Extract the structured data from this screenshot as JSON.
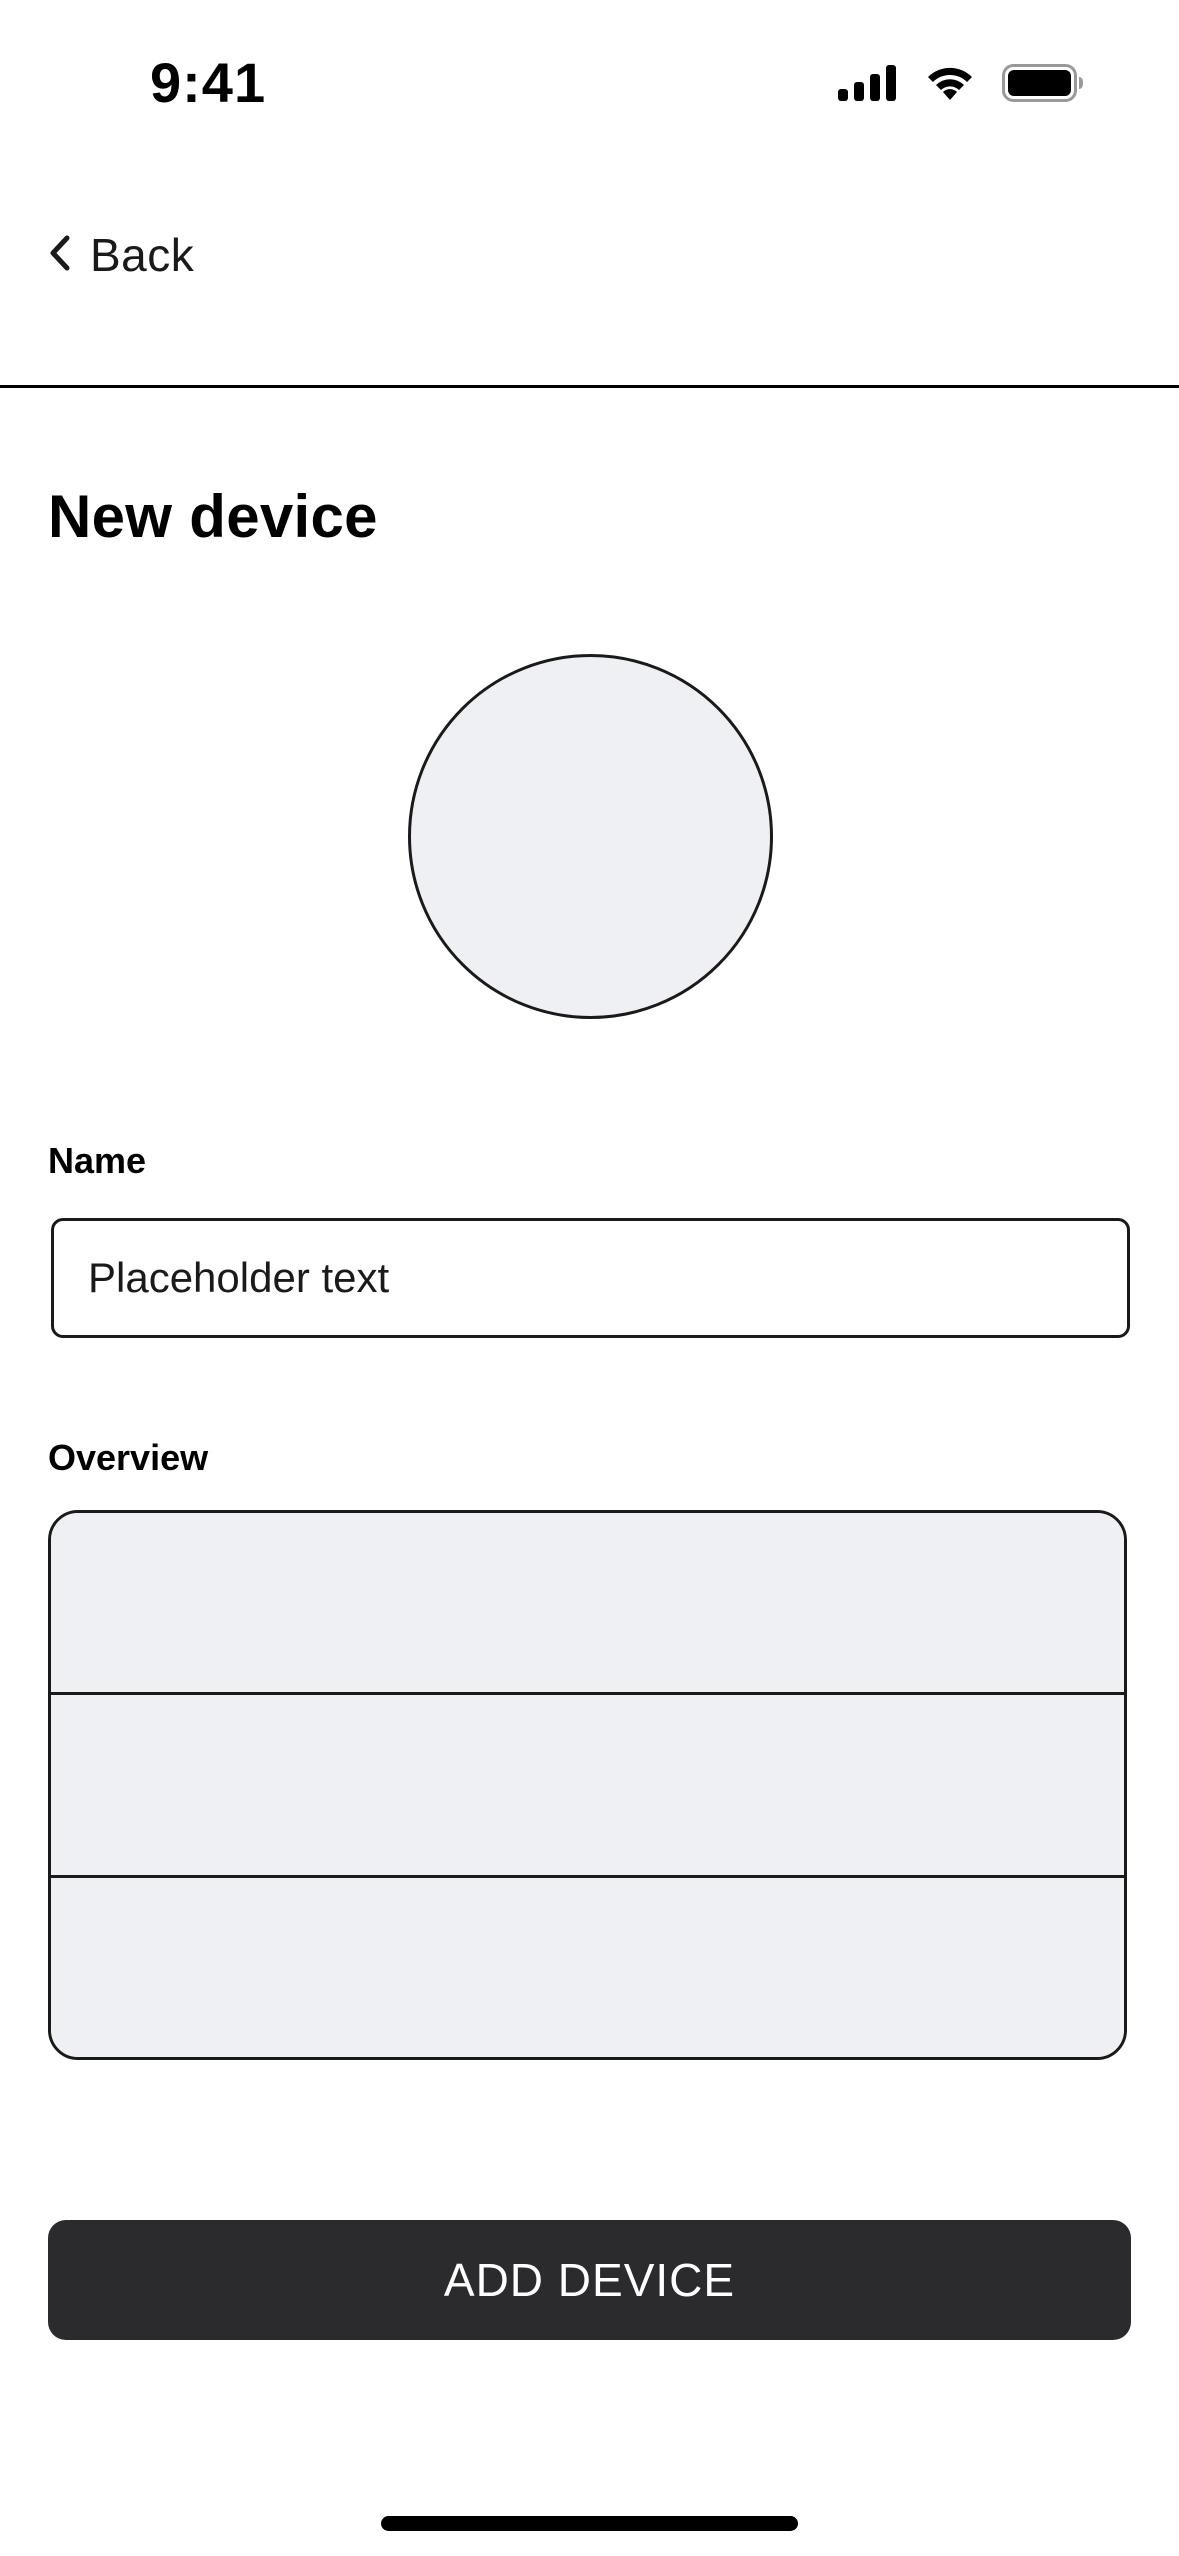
{
  "status_bar": {
    "time": "9:41",
    "icons": [
      "cellular-signal-icon",
      "wifi-icon",
      "battery-icon"
    ]
  },
  "nav": {
    "back_label": "Back",
    "back_icon": "chevron-left-icon"
  },
  "page": {
    "title": "New device"
  },
  "form": {
    "name_label": "Name",
    "name_value": "",
    "name_placeholder": "Placeholder text",
    "overview_label": "Overview",
    "overview_rows": [
      "",
      "",
      ""
    ]
  },
  "actions": {
    "add_label": "ADD DEVICE"
  },
  "colors": {
    "accent": "#2b2b2d",
    "surface": "#eff0f4",
    "border": "#1a1a1a",
    "background": "#ffffff"
  }
}
